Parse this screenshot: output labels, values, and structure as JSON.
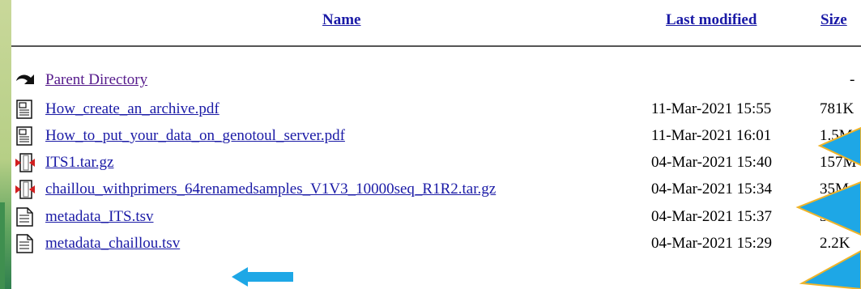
{
  "header": {
    "name": "Name",
    "last_modified": "Last modified",
    "size": "Size"
  },
  "rows": [
    {
      "name": "Parent Directory",
      "date": "",
      "size": "-",
      "icon": "back-icon"
    },
    {
      "name": "How_create_an_archive.pdf",
      "date": "11-Mar-2021 15:55",
      "size": "781K",
      "icon": "document-icon"
    },
    {
      "name": "How_to_put_your_data_on_genotoul_server.pdf",
      "date": "11-Mar-2021 16:01",
      "size": "1.5M",
      "icon": "document-icon"
    },
    {
      "name": "ITS1.tar.gz",
      "date": "04-Mar-2021 15:40",
      "size": "157M",
      "icon": "archive-icon"
    },
    {
      "name": "chaillou_withprimers_64renamedsamples_V1V3_10000seq_R1R2.tar.gz",
      "date": "04-Mar-2021 15:34",
      "size": "35M",
      "icon": "archive-icon"
    },
    {
      "name": "metadata_ITS.tsv",
      "date": "04-Mar-2021 15:37",
      "size": "3K",
      "icon": "text-file-icon"
    },
    {
      "name": "metadata_chaillou.tsv",
      "date": "04-Mar-2021 15:29",
      "size": "2.2K",
      "icon": "text-file-icon"
    }
  ],
  "colors": {
    "link": "#1a1aa6",
    "visited": "#551a8b",
    "annotation_arrow": "#1ea7e6",
    "annotation_outline": "#f0b429"
  }
}
